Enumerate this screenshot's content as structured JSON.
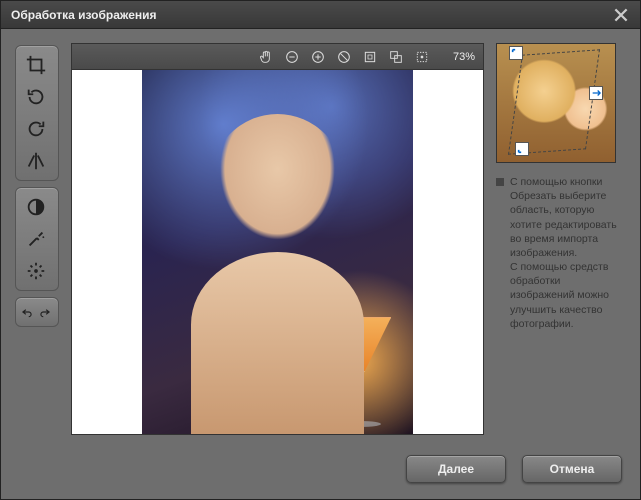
{
  "dialog": {
    "title": "Обработка изображения"
  },
  "canvas": {
    "zoom": "73%"
  },
  "help": {
    "text": "С помощью кнопки Обрезать выберите область, которую хотите редактировать во время импорта изображения.\nС помощью средств обработки изображений можно улучшить качество фотографии."
  },
  "footer": {
    "next": "Далее",
    "cancel": "Отмена"
  },
  "icons": {
    "crop": "crop",
    "rotate_right": "rotate-right",
    "rotate_left": "rotate-left",
    "flip": "flip",
    "contrast": "contrast",
    "auto_fix": "auto-fix",
    "redeye": "redeye",
    "undo": "undo",
    "redo": "redo",
    "hand": "hand",
    "zoom_out": "zoom-out",
    "zoom_in": "zoom-in",
    "no": "no",
    "fit": "fit",
    "layers": "layers",
    "actual": "actual"
  }
}
